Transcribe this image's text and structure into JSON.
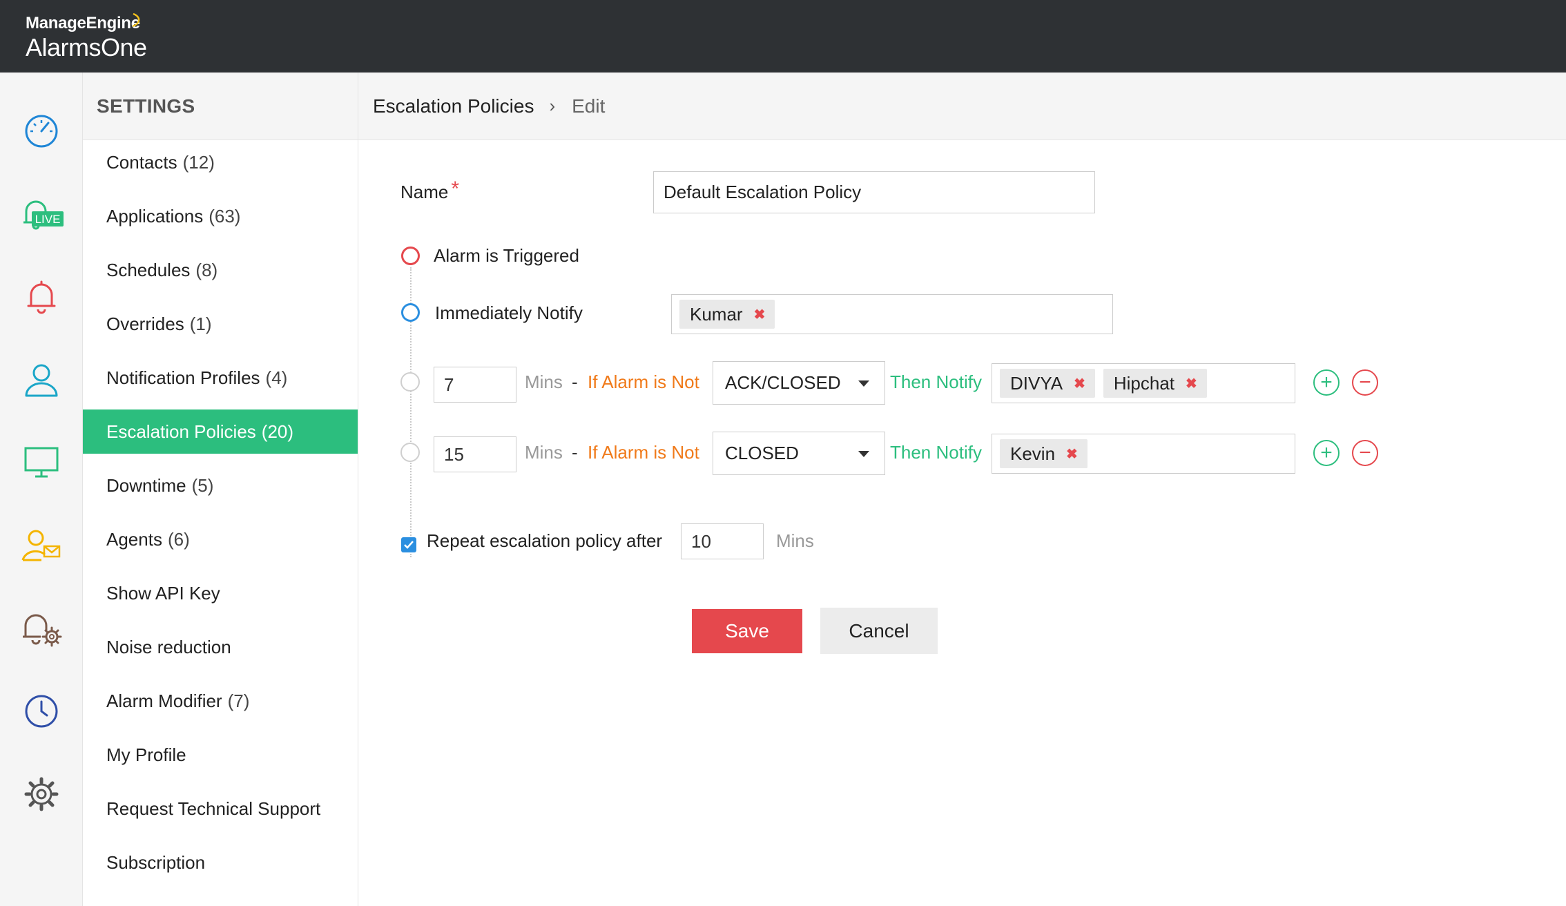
{
  "app": {
    "vendor": "ManageEngine",
    "product": "AlarmsOne"
  },
  "rail": {
    "items": [
      {
        "icon": "dashboard-gauge-icon"
      },
      {
        "icon": "live-alarms-icon",
        "badge": "LIVE"
      },
      {
        "icon": "bell-icon"
      },
      {
        "icon": "user-icon"
      },
      {
        "icon": "monitor-icon"
      },
      {
        "icon": "user-mail-icon"
      },
      {
        "icon": "bell-gear-icon"
      },
      {
        "icon": "clock-icon"
      },
      {
        "icon": "settings-gear-icon"
      }
    ]
  },
  "settings": {
    "title": "SETTINGS",
    "items": [
      {
        "label": "Contacts",
        "count": "(12)"
      },
      {
        "label": "Applications",
        "count": "(63)"
      },
      {
        "label": "Schedules",
        "count": "(8)"
      },
      {
        "label": "Overrides",
        "count": "(1)"
      },
      {
        "label": "Notification Profiles",
        "count": "(4)"
      },
      {
        "label": "Escalation Policies",
        "count": "(20)",
        "active": true
      },
      {
        "label": "Downtime",
        "count": "(5)"
      },
      {
        "label": "Agents",
        "count": "(6)"
      },
      {
        "label": "Show API Key",
        "count": ""
      },
      {
        "label": "Noise reduction",
        "count": ""
      },
      {
        "label": "Alarm Modifier",
        "count": "(7)"
      },
      {
        "label": "My Profile",
        "count": ""
      },
      {
        "label": "Request Technical Support",
        "count": ""
      },
      {
        "label": "Subscription",
        "count": ""
      }
    ]
  },
  "breadcrumb": {
    "parent": "Escalation Policies",
    "separator": "›",
    "current": "Edit"
  },
  "form": {
    "name_label": "Name",
    "required_mark": "*",
    "name_value": "Default Escalation Policy",
    "trigger_label": "Alarm is Triggered",
    "immediate_label": "Immediately Notify",
    "immediate_tags": [
      "Kumar"
    ],
    "mins_label": "Mins",
    "dash": "-",
    "if_label": "If Alarm is Not",
    "then_label": "Then Notify",
    "steps": [
      {
        "mins": "7",
        "status": "ACK/CLOSED",
        "tags": [
          "DIVYA",
          "Hipchat"
        ]
      },
      {
        "mins": "15",
        "status": "CLOSED",
        "tags": [
          "Kevin"
        ]
      }
    ],
    "repeat_checked": true,
    "repeat_label": "Repeat escalation policy after",
    "repeat_value": "10",
    "repeat_unit": "Mins"
  },
  "actions": {
    "save": "Save",
    "cancel": "Cancel"
  },
  "colors": {
    "topbar": "#2e3134",
    "active_green": "#2cbe7e",
    "save_red": "#e5484d",
    "orange_text": "#f07a1a",
    "blue": "#2b8fe0"
  }
}
